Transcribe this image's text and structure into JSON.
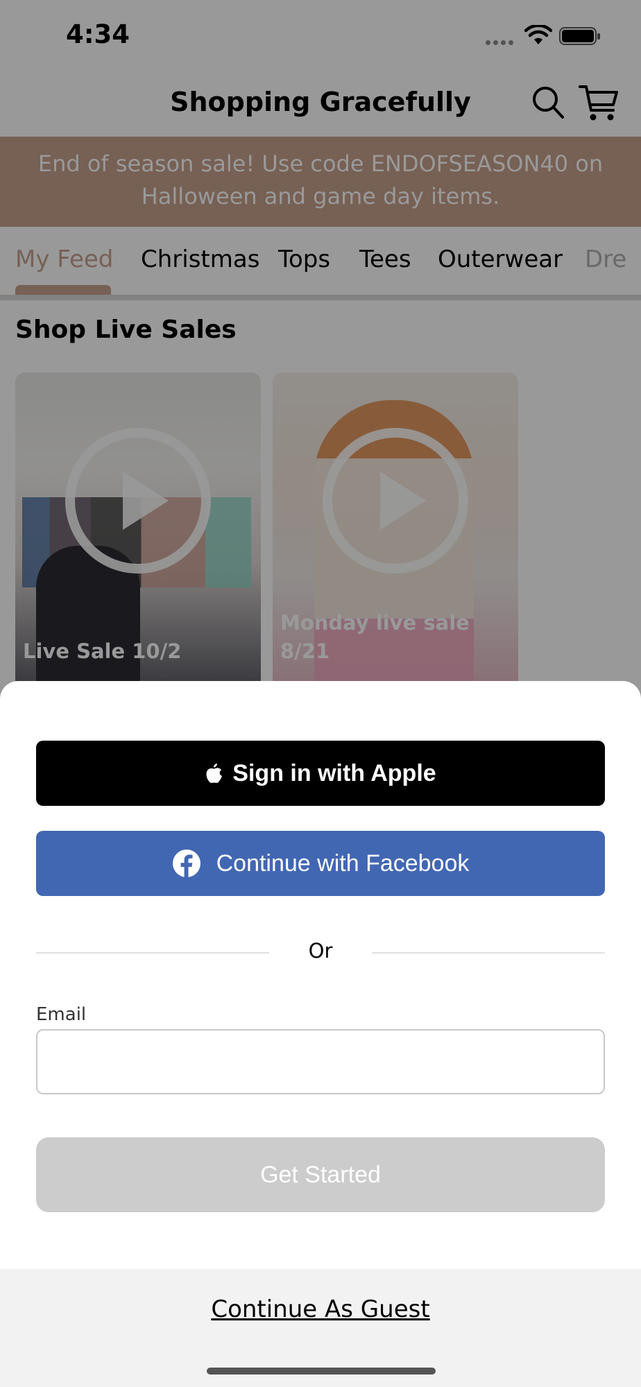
{
  "status_bar": {
    "time": "4:34"
  },
  "header": {
    "title": "Shopping Gracefully",
    "search_icon": "search-icon",
    "cart_icon": "cart-icon"
  },
  "promo_banner": {
    "line1": "End of season sale! Use code ENDOFSEASON40 on",
    "line2": "Halloween and game day items.",
    "color": "#c7a18d"
  },
  "tabs": [
    {
      "label": "My Feed",
      "active": true
    },
    {
      "label": "Christmas",
      "active": false
    },
    {
      "label": "Tops",
      "active": false
    },
    {
      "label": "Tees",
      "active": false
    },
    {
      "label": "Outerwear",
      "active": false
    },
    {
      "label": "Dre",
      "active": false
    }
  ],
  "section_title": "Shop Live Sales",
  "live_sales": [
    {
      "title": "Live Sale 10/2",
      "meta": ""
    },
    {
      "title_line1": "Monday live sale",
      "title_line2": "8/21",
      "meta": ""
    }
  ],
  "sheet": {
    "apple_button": "Sign in with Apple",
    "facebook_button": "Continue with Facebook",
    "or_text": "Or",
    "email_label": "Email",
    "email_value": "",
    "email_placeholder": "",
    "get_started_button": "Get Started",
    "continue_guest": "Continue As Guest",
    "colors": {
      "apple_bg": "#000000",
      "facebook_bg": "#4267b2",
      "get_started_bg": "#cccccc"
    }
  }
}
